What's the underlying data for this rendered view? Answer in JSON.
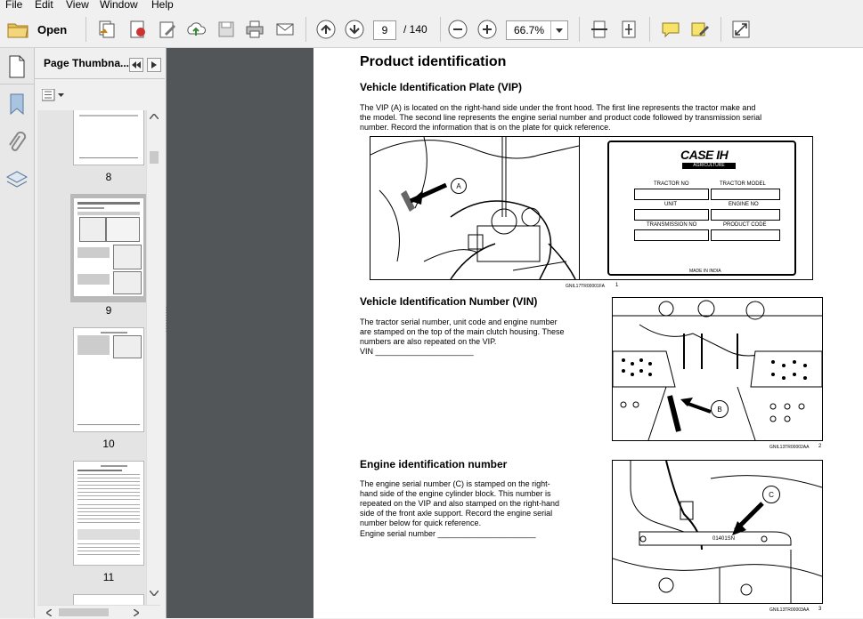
{
  "menu": [
    "File",
    "Edit",
    "View",
    "Window",
    "Help"
  ],
  "toolbar": {
    "open_label": "Open",
    "page_current": "9",
    "page_total": "/ 140",
    "zoom": "66.7%"
  },
  "panel": {
    "title": "Page Thumbna...",
    "thumb_labels": [
      "8",
      "9",
      "10",
      "11"
    ]
  },
  "document": {
    "title": "Product identification",
    "vip_heading": "Vehicle Identification Plate (VIP)",
    "vip_text_1": "The VIP (A) is located on the right-hand side under the front hood.  The first line represents the tractor make and",
    "vip_text_2": "the model.  The second line represents the engine serial number and product code followed by transmission serial",
    "vip_text_3": "number.  Record the information that is on the plate for quick reference.",
    "fig1_caption": "GNIL17TR00001FA",
    "fig1_num": "1",
    "plate": {
      "brand": "CASE IH",
      "sub": "AGRICULTURE",
      "fields": [
        "TRACTOR  NO",
        "TRACTOR  MODEL",
        "UNIT",
        "ENGINE  NO",
        "TRANSMISSION  NO",
        "PRODUCT  CODE"
      ],
      "made_in": "MADE  IN  INDIA"
    },
    "callout_a": "A",
    "vin_heading": "Vehicle Identification Number (VIN)",
    "vin_text_1": "The tractor serial number, unit code and engine number",
    "vin_text_2": "are stamped on the top of the main clutch housing. These",
    "vin_text_3": "numbers are also repeated on the VIP.",
    "vin_line": "VIN ______________________",
    "fig2_caption": "GNIL13TR00002AA",
    "fig2_num": "2",
    "callout_b": "B",
    "engine_heading": "Engine identification number",
    "engine_text_1": "The engine serial number (C) is stamped on the right-",
    "engine_text_2": "hand side of the engine cylinder block.  This number is",
    "engine_text_3": "repeated on the VIP and also stamped on the right-hand",
    "engine_text_4": "side of the front axle support.  Record the engine serial",
    "engine_text_5": "number below for quick reference.",
    "engine_line": "Engine serial number ______________________",
    "fig3_caption": "GNIL13TR00003AA",
    "fig3_num": "3",
    "callout_c": "C",
    "engine_stamp": "01401SN"
  }
}
